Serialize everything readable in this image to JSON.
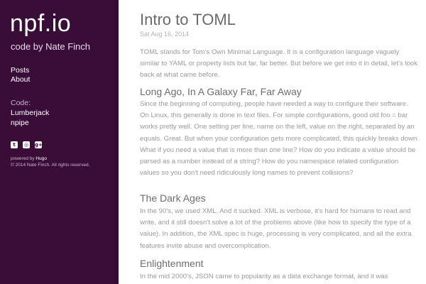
{
  "sidebar": {
    "site_title": "npf.io",
    "tagline": "code by Nate Finch",
    "nav_items": [
      {
        "label": "Posts"
      },
      {
        "label": "About"
      }
    ],
    "code_label": "Code:",
    "code_items": [
      {
        "label": "Lumberjack"
      },
      {
        "label": "npipe"
      }
    ],
    "social_icons": [
      {
        "name": "twitter-icon",
        "glyph": "t"
      },
      {
        "name": "github-icon",
        "glyph": "◎"
      },
      {
        "name": "google-plus-icon",
        "glyph": "g+"
      }
    ],
    "powered_prefix": "powered by ",
    "powered_by": "Hugo",
    "copyright": "© 2014 Nate Finch. All rights reserved."
  },
  "post": {
    "title": "Intro to TOML",
    "date": "Sat Aug 16, 2014",
    "intro": "TOML stands for Tom's Own Minimal Language. It is a configuration language vaguely similar to YAML or property lists but far, far better. But before we get into it in detail, let's look back at what came before.",
    "sections": [
      {
        "heading": "Long Ago, In A Galaxy Far, Far Away",
        "body": "Since the beginning of computing, people have needed a way to configure their software. On Linux, this generally is done in text files. For simple configurations, good old foo = bar works pretty well. One setting per line, name on the left, value on the right, separated by an equals. Great. But when your configuration gets more complicated, this quickly breaks down. What if you need a value that is more than one line? How do you indicate a value should be parsed as a number instead of a string? How do you namespace related configuration values so you don't need ridiculously long names to prevent collisions?"
      },
      {
        "heading": "The Dark Ages",
        "body": "In the 90's, we used XML. And it sucked. XML is verbose, it's hard for humans to read and write, and it still doesn't solve a lot of the problems above (like how to specify the type of a value). In addition, the XML spec is huge, processing is very complicated, and all the extra features invite abuse and overcomplication."
      },
      {
        "heading": "Enlightenment",
        "body": "In the mid 2000's, JSON came to popularity as a data exchange format, and it was"
      }
    ]
  },
  "colors": {
    "sidebar_bg": "#3a0d39",
    "sidebar_text": "#ffffff",
    "body_text": "#9a9a9a",
    "heading_text": "#6e6e6e"
  }
}
